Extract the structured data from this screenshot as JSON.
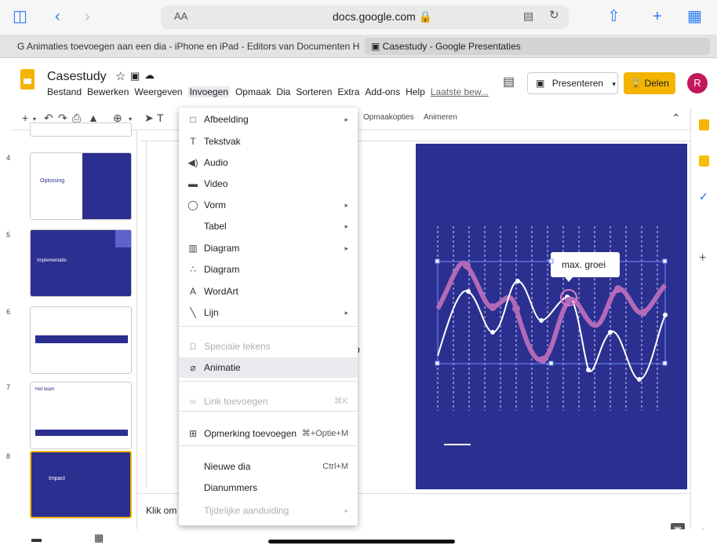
{
  "browser": {
    "url_aa": "AA",
    "url": "docs.google.com 🔒",
    "tabs": [
      {
        "label": "G  Animaties toevoegen aan een dia - iPhone en iPad - Editors van Documenten H"
      },
      {
        "label": "▣  Casestudy - Google Presentaties"
      }
    ]
  },
  "docs": {
    "title": "Casestudy",
    "menu": [
      "Bestand",
      "Bewerken",
      "Weergeven",
      "Invoegen",
      "Opmaak",
      "Dia",
      "Sorteren",
      "Extra",
      "Add-ons",
      "Help"
    ],
    "last_edit": "Laatste bew...",
    "present_label": "Presenteren",
    "share_label": "Delen",
    "avatar_letter": "R"
  },
  "toolbar": {
    "opmaakopties": "Opmaakopties",
    "animeren": "Animeren"
  },
  "slides": [
    {
      "num": "4",
      "title": "Oplossing"
    },
    {
      "num": "5",
      "title": "Implementatie"
    },
    {
      "num": "6",
      "title": ""
    },
    {
      "num": "7",
      "title": "Het team"
    },
    {
      "num": "8",
      "title": "Impact"
    }
  ],
  "chart_label": "max. groei",
  "notes": "Klik om s",
  "canvas_partial": "b",
  "insert_menu": {
    "items": [
      {
        "icon": "image-icon",
        "glyph": "□",
        "label": "Afbeelding",
        "arrow": true
      },
      {
        "icon": "textbox-icon",
        "glyph": "T",
        "label": "Tekstvak"
      },
      {
        "icon": "audio-icon",
        "glyph": "◀)",
        "label": "Audio"
      },
      {
        "icon": "video-icon",
        "glyph": "▬",
        "label": "Video"
      },
      {
        "icon": "shape-icon",
        "glyph": "◯",
        "label": "Vorm",
        "arrow": true
      },
      {
        "icon": "table-icon",
        "glyph": "",
        "label": "Tabel",
        "arrow": true
      },
      {
        "icon": "chart-icon",
        "glyph": "▥",
        "label": "Diagram",
        "arrow": true
      },
      {
        "icon": "diagram-icon",
        "glyph": "∴",
        "label": "Diagram"
      },
      {
        "icon": "wordart-icon",
        "glyph": "A",
        "label": "WordArt"
      },
      {
        "icon": "line-icon",
        "glyph": "╲",
        "label": "Lijn",
        "arrow": true
      },
      {
        "icon": "special-chars-icon",
        "glyph": "Ω",
        "label": "Speciale tekens",
        "disabled": true
      },
      {
        "icon": "animation-icon",
        "glyph": "⌀",
        "label": "Animatie",
        "highlight": true
      },
      {
        "icon": "link-icon",
        "glyph": "∞",
        "label": "Link toevoegen",
        "shortcut": "⌘K",
        "disabled": true
      },
      {
        "icon": "comment-add-icon",
        "glyph": "⊞",
        "label": "Opmerking toevoegen",
        "shortcut": "⌘+Optie+M"
      },
      {
        "icon": "",
        "glyph": "",
        "label": "Nieuwe dia",
        "shortcut": "Ctrl+M"
      },
      {
        "icon": "",
        "glyph": "",
        "label": "Dianummers"
      },
      {
        "icon": "",
        "glyph": "",
        "label": "Tijdelijke aanduiding",
        "arrow": true,
        "disabled": true
      }
    ],
    "arrow_glyph": "▸"
  }
}
